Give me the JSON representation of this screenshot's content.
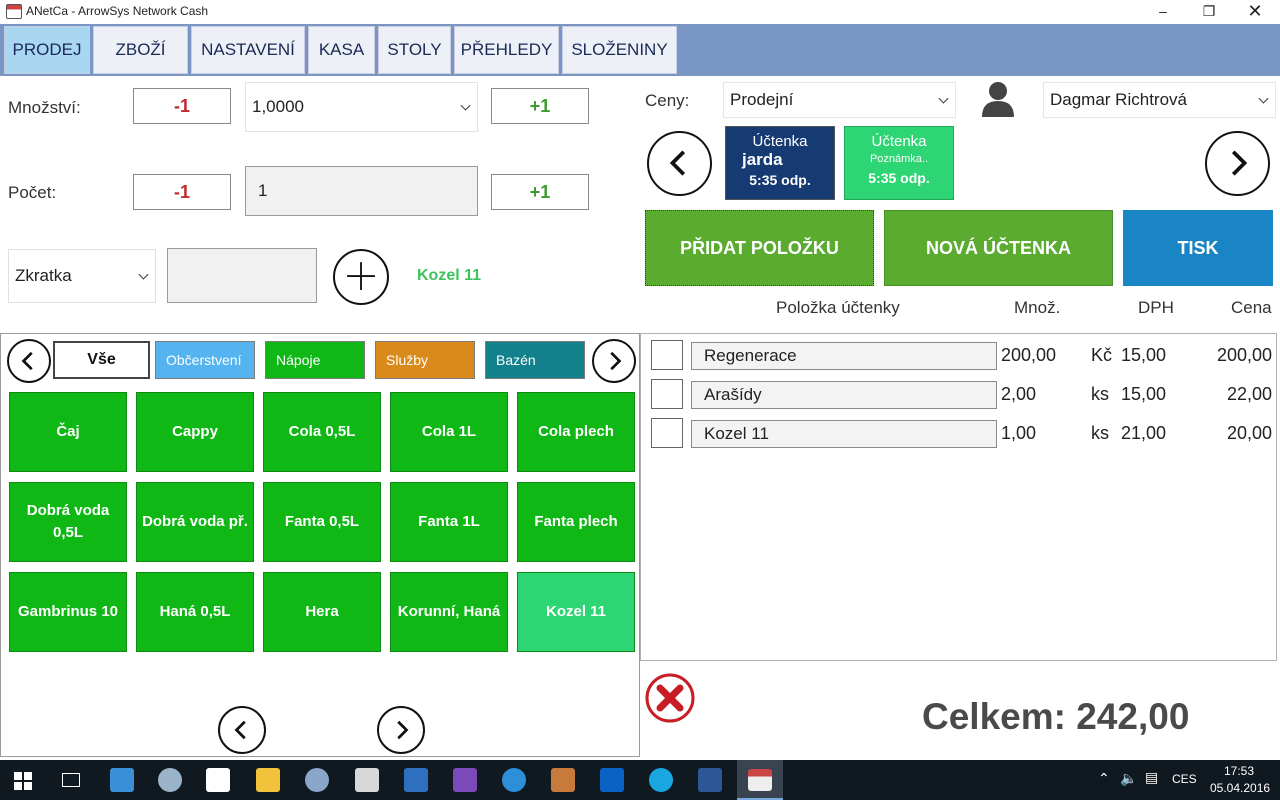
{
  "window": {
    "title": "ANetCa - ArrowSys Network Cash"
  },
  "tabs": [
    "PRODEJ",
    "ZBOŽÍ",
    "NASTAVENÍ",
    "KASA",
    "STOLY",
    "PŘEHLEDY",
    "SLOŽENINY"
  ],
  "left": {
    "quantity_label": "Množství:",
    "quantity_minus": "-1",
    "quantity_value": "1,0000",
    "quantity_plus": "+1",
    "count_label": "Počet:",
    "count_minus": "-1",
    "count_value": "1",
    "count_plus": "+1",
    "shortcut_select": "Zkratka",
    "shortcut_input": "",
    "selected_product": "Kozel 11"
  },
  "categories": [
    "Vše",
    "Občerstvení",
    "Nápoje",
    "Služby",
    "Bazén"
  ],
  "products": [
    "Čaj",
    "Cappy",
    "Cola 0,5L",
    "Cola 1L",
    "Cola plech",
    "Dobrá voda 0,5L",
    "Dobrá voda př.",
    "Fanta 0,5L",
    "Fanta 1L",
    "Fanta plech",
    "Gambrinus 10",
    "Haná 0,5L",
    "Hera",
    "Korunní, Haná",
    "Kozel 11"
  ],
  "right": {
    "price_label": "Ceny:",
    "price_value": "Prodejní",
    "user": "Dagmar  Richtrová",
    "receipts": [
      {
        "title": "Účtenka",
        "name": "jarda",
        "note": "",
        "time": "5:35 odp."
      },
      {
        "title": "Účtenka",
        "name": "",
        "note": "Poznámka..",
        "time": "5:35 odp."
      }
    ],
    "add_item": "PŘIDAT POLOŽKU",
    "new_receipt": "NOVÁ ÚČTENKA",
    "print": "TISK",
    "columns": {
      "item": "Položka účtenky",
      "qty": "Množ.",
      "vat": "DPH",
      "price": "Cena"
    },
    "items": [
      {
        "name": "Regenerace",
        "qty": "200,00",
        "unit": "Kč",
        "vat": "15,00",
        "price": "200,00"
      },
      {
        "name": "Arašídy",
        "qty": "2,00",
        "unit": "ks",
        "vat": "15,00",
        "price": "22,00"
      },
      {
        "name": "Kozel 11",
        "qty": "1,00",
        "unit": "ks",
        "vat": "21,00",
        "price": "20,00"
      }
    ],
    "total": "Celkem: 242,00"
  },
  "taskbar": {
    "lang": "CES",
    "time": "17:53",
    "date": "05.04.2016"
  },
  "colors": {
    "green": "#0fb815",
    "tab_bar": "#7a96c4",
    "receipt_blue": "#163b72",
    "print_blue": "#1a85c4"
  }
}
